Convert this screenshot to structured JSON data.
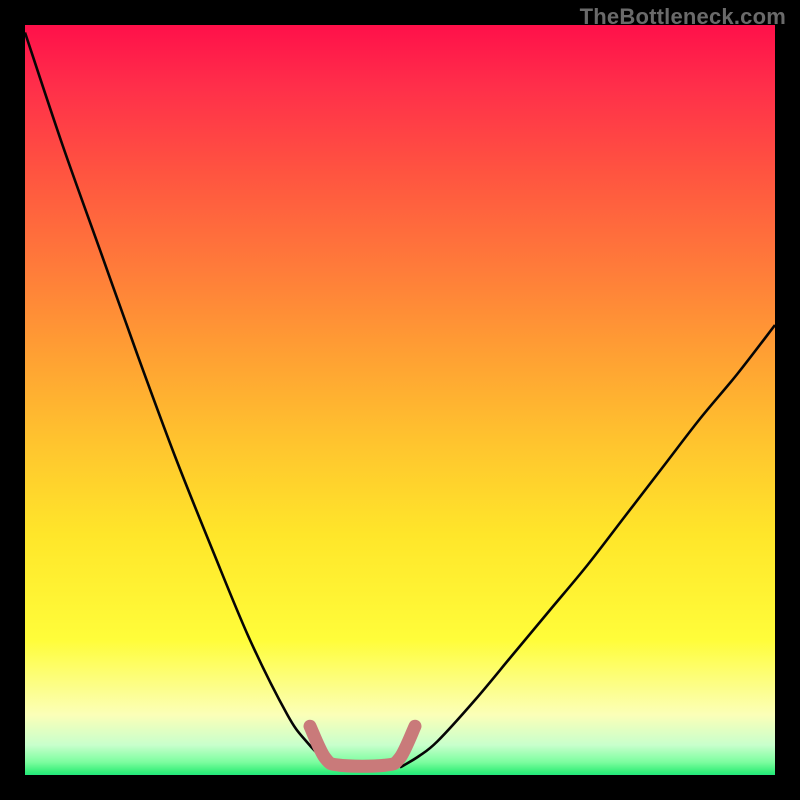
{
  "watermark": "TheBottleneck.com",
  "chart_data": {
    "type": "line",
    "title": "",
    "xlabel": "",
    "ylabel": "",
    "xlim": [
      0,
      100
    ],
    "ylim": [
      0,
      100
    ],
    "series": [
      {
        "name": "black-curve-left",
        "x": [
          0,
          5,
          10,
          15,
          20,
          25,
          30,
          35,
          37.5,
          40,
          42
        ],
        "values": [
          99,
          84,
          70,
          56,
          42.5,
          30,
          18,
          8,
          4.5,
          2,
          1
        ]
      },
      {
        "name": "black-curve-right",
        "x": [
          50,
          52.5,
          55,
          60,
          65,
          70,
          75,
          80,
          85,
          90,
          95,
          100
        ],
        "values": [
          1,
          2.5,
          4.5,
          10,
          16,
          22,
          28,
          34.5,
          41,
          47.5,
          53.5,
          60
        ]
      },
      {
        "name": "red-bracket",
        "x": [
          38,
          40,
          42,
          48,
          50,
          52
        ],
        "values": [
          6.5,
          2.3,
          1.3,
          1.3,
          2.3,
          6.5
        ]
      }
    ],
    "colors": {
      "black": "#050505",
      "red_bracket": "#c97a7a",
      "gradient": [
        "#ff104a",
        "#ffc52e",
        "#fffd3a",
        "#23e87c"
      ]
    }
  }
}
